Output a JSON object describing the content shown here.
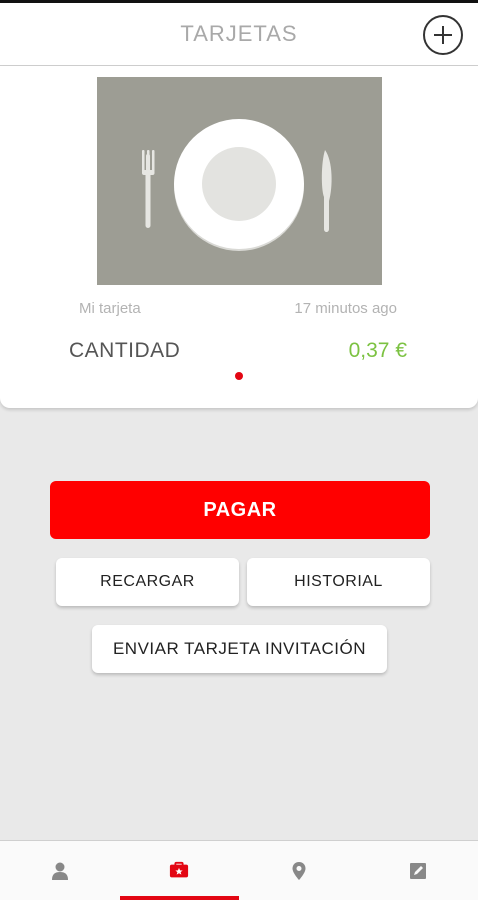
{
  "header": {
    "title": "TARJETAS",
    "add_icon": "plus-circle-icon"
  },
  "card": {
    "image_icon": "plate-cutlery-icon",
    "name": "Mi tarjeta",
    "time": "17 minutos ago",
    "amount_label": "CANTIDAD",
    "amount_value": "0,37 €",
    "page_indicator": {
      "current": 1,
      "total": 1
    }
  },
  "actions": {
    "pay_label": "PAGAR",
    "recharge_label": "RECARGAR",
    "history_label": "HISTORIAL",
    "invite_label": "ENVIAR TARJETA INVITACIÓN"
  },
  "bottom_nav": {
    "items": [
      {
        "icon": "user-icon",
        "active": false
      },
      {
        "icon": "card-icon",
        "active": true
      },
      {
        "icon": "location-pin-icon",
        "active": false
      },
      {
        "icon": "edit-note-icon",
        "active": false
      }
    ]
  },
  "colors": {
    "accent": "#ff0000",
    "amount_green": "#7cc242",
    "background": "#e9e9e9",
    "card_image": "#9d9d94"
  }
}
